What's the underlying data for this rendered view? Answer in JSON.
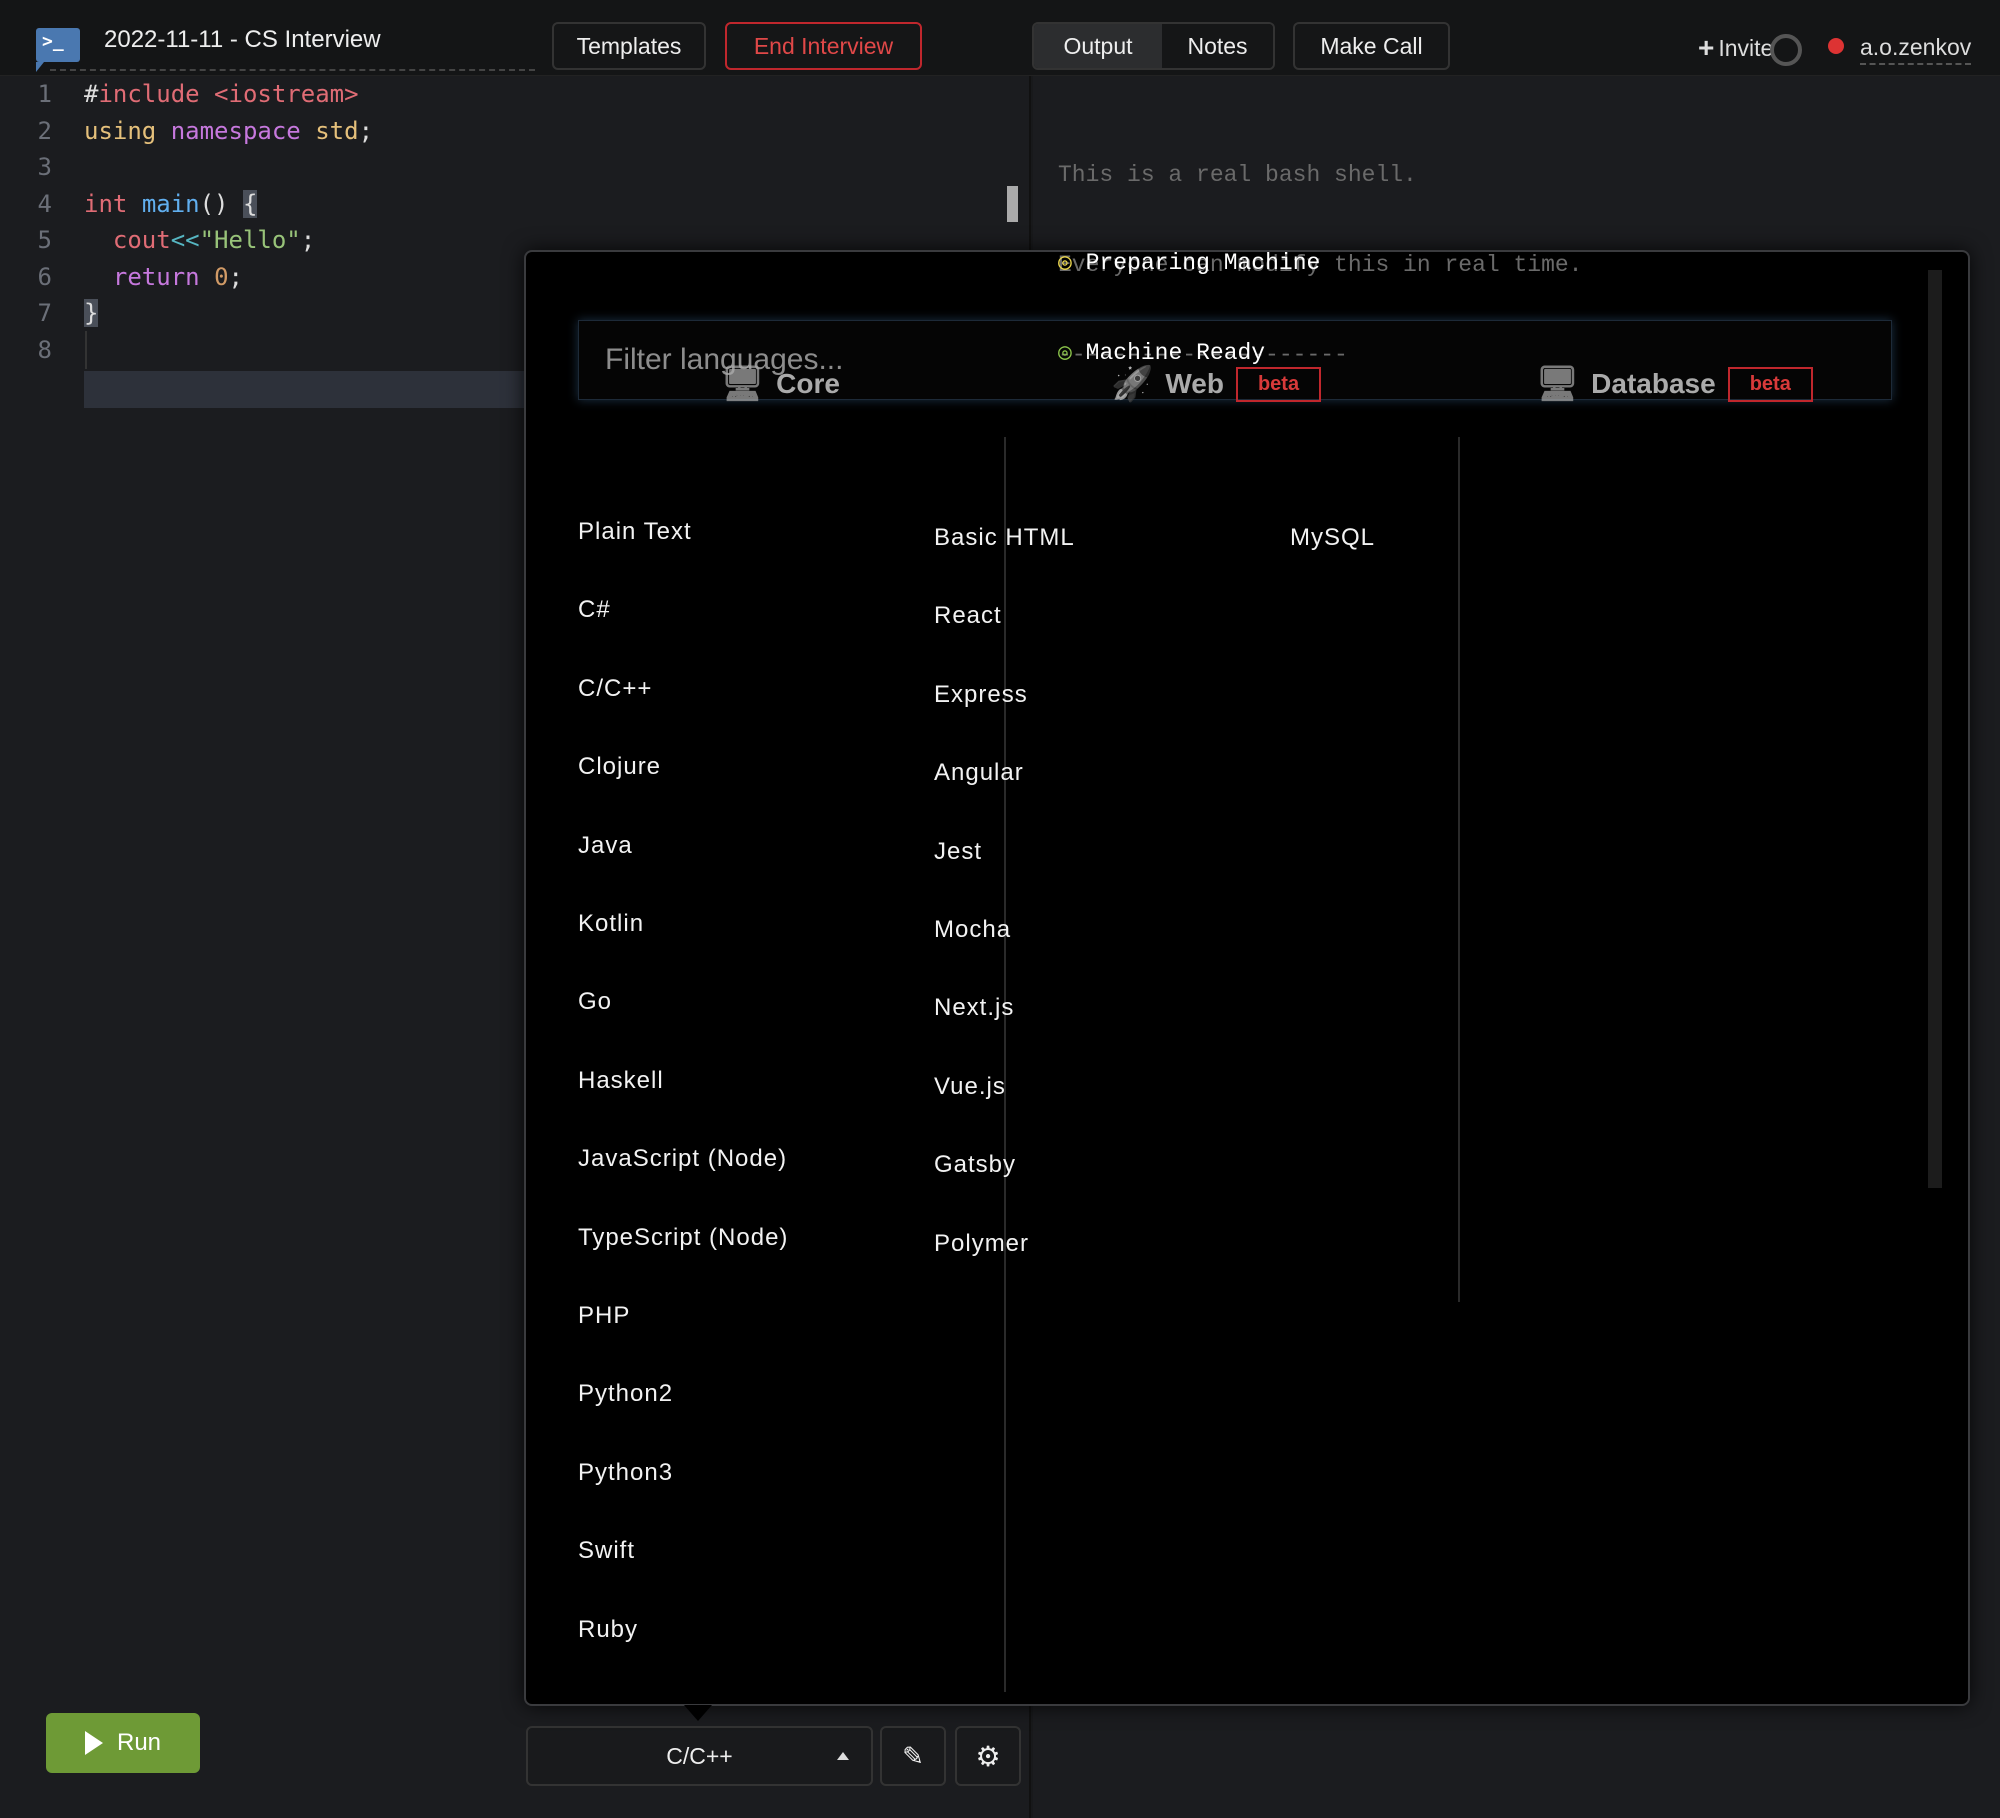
{
  "header": {
    "title": "2022-11-11 - CS Interview",
    "templates_label": "Templates",
    "end_interview_label": "End Interview",
    "tabs": [
      {
        "label": "Output",
        "active": true
      },
      {
        "label": "Notes",
        "active": false
      }
    ],
    "make_call_label": "Make Call",
    "invite_label": "Invite",
    "username": "a.o.zenkov",
    "accent_red": "#c0272d"
  },
  "editor": {
    "lines": [
      {
        "n": "1",
        "html": "<span style='color:#ddd'>#</span><span style='color:#e06c75'>include &lt;iostream&gt;</span>"
      },
      {
        "n": "2",
        "html": "<span style='color:#e5c07b'>using</span> <span style='color:#c678dd'>namespace</span> <span style='color:#e5c07b'>std</span>;"
      },
      {
        "n": "3",
        "html": ""
      },
      {
        "n": "4",
        "html": "<span style='color:#e06c75'>int</span> <span style='color:#61afef'>main</span>() <span style='background:#4a4f59'>{</span>"
      },
      {
        "n": "5",
        "html": "  <span style='color:#e06c75'>cout</span><span style='color:#56b6c2'>&lt;&lt;</span><span style='color:#98c379'>\"Hello\"</span>;"
      },
      {
        "n": "6",
        "html": "  <span style='color:#c678dd'>return</span> <span style='color:#d19a66'>0</span>;"
      },
      {
        "n": "7",
        "html": "<span style='background:#4a4f59'>}</span>"
      },
      {
        "n": "8",
        "html": ""
      }
    ]
  },
  "output": {
    "intro": [
      "This is a real bash shell.",
      "Everyone can modify this in real time.",
      "---------------------"
    ],
    "status": [
      {
        "text": "Preparing Machine",
        "color": "#e8d44d"
      },
      {
        "text": "Machine Ready",
        "color": "#8bc34a"
      }
    ]
  },
  "language_picker": {
    "filter_placeholder": "Filter languages...",
    "columns": [
      {
        "title": "Core",
        "icon": "computer-code-gear-icon",
        "badge": "",
        "items": [
          "Plain Text",
          "C#",
          "C/C++",
          "Clojure",
          "Java",
          "Kotlin",
          "Go",
          "Haskell",
          "JavaScript (Node)",
          "TypeScript (Node)",
          "PHP",
          "Python2",
          "Python3",
          "Swift",
          "Ruby"
        ]
      },
      {
        "title": "Web",
        "icon": "rocket-laptop-icon",
        "badge": "beta",
        "items": [
          "Basic HTML",
          "React",
          "Express",
          "Angular",
          "Jest",
          "Mocha",
          "Next.js",
          "Vue.js",
          "Gatsby",
          "Polymer"
        ]
      },
      {
        "title": "Database",
        "icon": "computer-code-gear-icon",
        "badge": "beta",
        "items": [
          "MySQL"
        ]
      }
    ]
  },
  "footer": {
    "run_label": "Run",
    "selected_language": "C/C++",
    "run_color": "#6e9a36"
  }
}
